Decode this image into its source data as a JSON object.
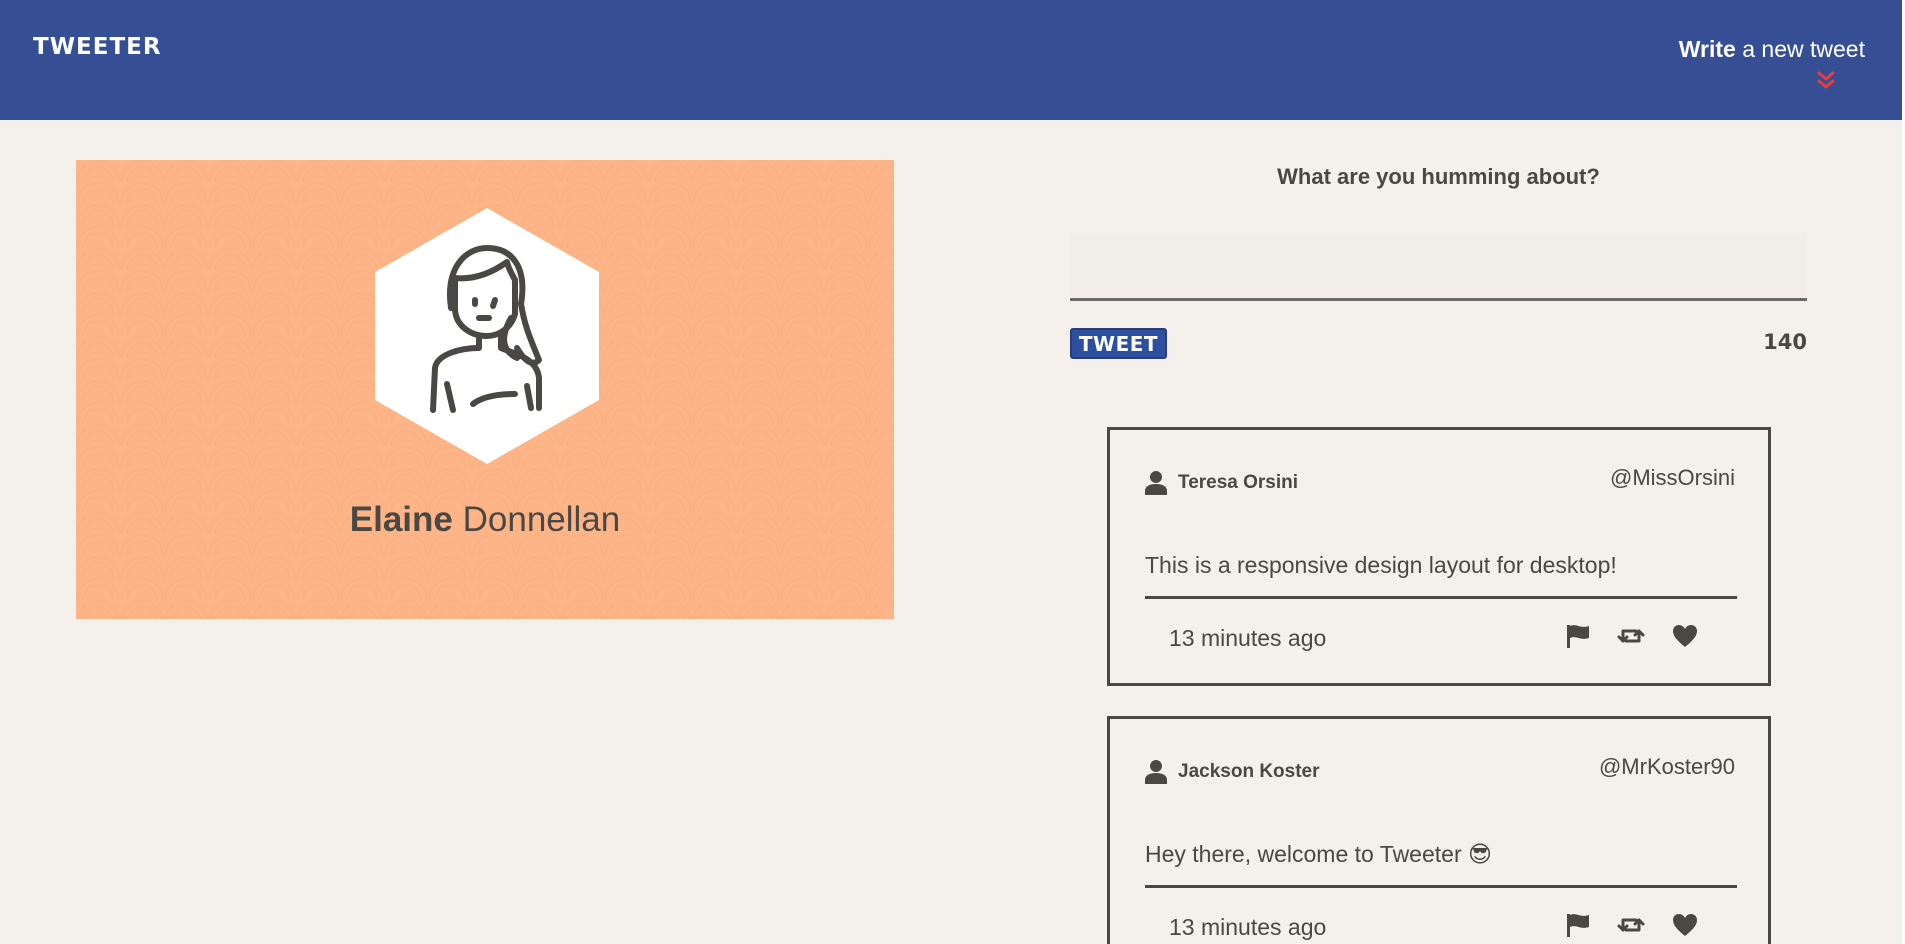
{
  "nav": {
    "brand": "TWEETER",
    "compose_bold": "Write",
    "compose_rest": "a new tweet",
    "accent_color": "#e53e3e",
    "bg_color": "#364f94"
  },
  "profile": {
    "first_name": "Elaine",
    "last_name": "Donnellan",
    "avatar_icon": "woman-avatar-icon",
    "card_color": "#fdb588"
  },
  "compose": {
    "label": "What are you humming about?",
    "text_value": "",
    "button_label": "TWEET",
    "counter": "140"
  },
  "tweets": [
    {
      "author": "Teresa Orsini",
      "handle": "@MissOrsini",
      "body": "This is a responsive design layout for desktop!",
      "time": "13 minutes ago",
      "icons": [
        "flag-icon",
        "retweet-icon",
        "heart-icon"
      ]
    },
    {
      "author": "Jackson Koster",
      "handle": "@MrKoster90",
      "body": "Hey there, welcome to Tweeter 😎",
      "time": "13 minutes ago",
      "icons": [
        "flag-icon",
        "retweet-icon",
        "heart-icon"
      ]
    }
  ]
}
